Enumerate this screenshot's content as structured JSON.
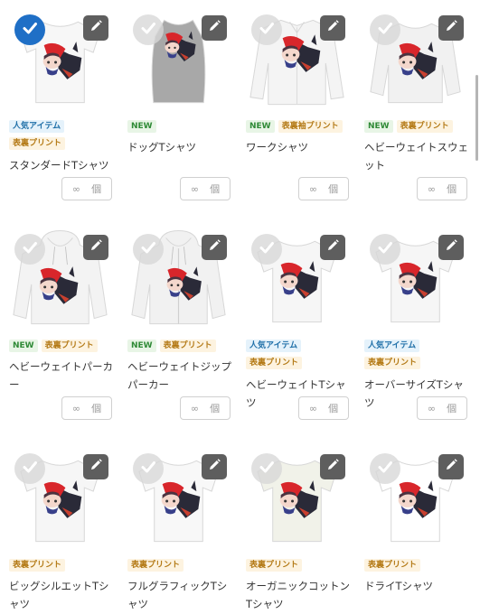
{
  "tag_labels": {
    "popular": "人気アイテム",
    "new": "NEW",
    "print": "表裏プリント",
    "sleeve": "表裏袖プリント"
  },
  "quantity": {
    "placeholder": "∞",
    "unit": "個"
  },
  "icons": {
    "select": "checkmark-icon",
    "edit": "pencil-icon"
  },
  "colors": {
    "selected": "#1f6fc6",
    "new_tag": "#2f8a36",
    "popular_tag": "#1f6fa8",
    "print_tag": "#b47a16"
  },
  "items": [
    {
      "name": "スタンダードTシャツ",
      "tags": [
        "popular",
        "print"
      ],
      "shape": "tshirt",
      "garment": "#f7f7f7",
      "selected": true
    },
    {
      "name": "ドッグTシャツ",
      "tags": [
        "new"
      ],
      "shape": "dog",
      "garment": "#a8a8a8",
      "selected": false
    },
    {
      "name": "ワークシャツ",
      "tags": [
        "new",
        "sleeve"
      ],
      "shape": "work",
      "garment": "#f4f4f4",
      "selected": false
    },
    {
      "name": "ヘビーウェイトスウェット",
      "tags": [
        "new",
        "print"
      ],
      "shape": "sweat",
      "garment": "#f1f1f1",
      "selected": false
    },
    {
      "name": "ヘビーウェイトパーカー",
      "tags": [
        "new",
        "print"
      ],
      "shape": "hoodie",
      "garment": "#f3f3f3",
      "selected": false
    },
    {
      "name": "ヘビーウェイトジップパーカー",
      "tags": [
        "new",
        "print"
      ],
      "shape": "zip",
      "garment": "#f1f1f1",
      "selected": false
    },
    {
      "name": "ヘビーウェイトTシャツ",
      "tags": [
        "popular",
        "print"
      ],
      "shape": "tshirt",
      "garment": "#f6f6f6",
      "selected": false
    },
    {
      "name": "オーバーサイズTシャツ",
      "tags": [
        "popular",
        "print"
      ],
      "shape": "tshirt",
      "garment": "#f6f6f6",
      "selected": false
    },
    {
      "name": "ビッグシルエットTシャツ",
      "tags": [
        "print"
      ],
      "shape": "tshirt",
      "garment": "#f6f6f6",
      "selected": false
    },
    {
      "name": "フルグラフィックTシャツ",
      "tags": [
        "print"
      ],
      "shape": "tshirt",
      "garment": "#f8f8f8",
      "selected": false
    },
    {
      "name": "オーガニックコットンTシャツ",
      "tags": [
        "print"
      ],
      "shape": "tshirt",
      "garment": "#f1f2e9",
      "selected": false
    },
    {
      "name": "ドライTシャツ",
      "tags": [
        "print"
      ],
      "shape": "tshirt",
      "garment": "#ffffff",
      "selected": false
    }
  ]
}
